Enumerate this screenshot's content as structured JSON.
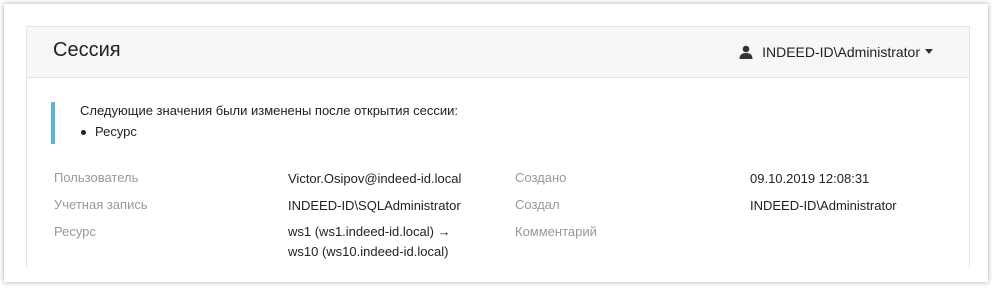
{
  "header": {
    "title": "Сессия",
    "user": "INDEED-ID\\Administrator",
    "user_icon": "user-icon"
  },
  "notice": {
    "text": "Следующие значения были изменены после открытия сессии:",
    "items": [
      "Ресурс"
    ],
    "accent_color": "#5bb4d4"
  },
  "fields": {
    "user": {
      "label": "Пользователь",
      "value": "Victor.Osipov@indeed-id.local"
    },
    "account": {
      "label": "Учетная запись",
      "value": "INDEED-ID\\SQLAdministrator"
    },
    "resource": {
      "label": "Ресурс",
      "value_line1": "ws1 (ws1.indeed-id.local) →",
      "value_line2": "ws10 (ws10.indeed-id.local)"
    },
    "created": {
      "label": "Создано",
      "value": "09.10.2019 12:08:31"
    },
    "created_by": {
      "label": "Создал",
      "value": "INDEED-ID\\Administrator"
    },
    "comment": {
      "label": "Комментарий",
      "value": ""
    }
  }
}
